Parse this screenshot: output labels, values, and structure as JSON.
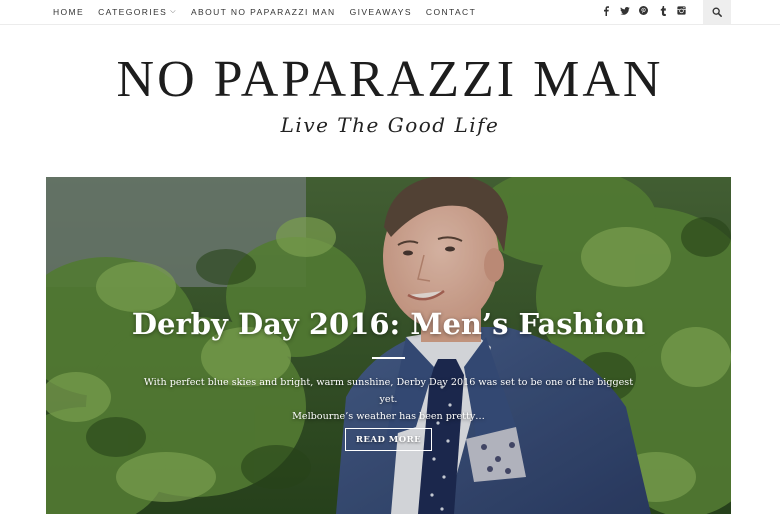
{
  "nav": {
    "items": [
      {
        "label": "HOME"
      },
      {
        "label": "CATEGORIES"
      },
      {
        "label": "ABOUT NO PAPARAZZI MAN"
      },
      {
        "label": "GIVEAWAYS"
      },
      {
        "label": "CONTACT"
      }
    ],
    "social": [
      "facebook-icon",
      "twitter-icon",
      "pinterest-icon",
      "tumblr-icon",
      "instagram-icon"
    ],
    "social_glyphs": [
      "f",
      "🐦",
      "p",
      "t",
      "◙"
    ],
    "search_icon": "search-icon"
  },
  "header": {
    "title": "NO PAPARAZZI MAN",
    "tagline": "Live The Good Life"
  },
  "hero": {
    "title": "Derby Day 2016: Men’s Fashion",
    "excerpt_line1": "With perfect blue skies and bright, warm sunshine, Derby Day 2016 was set to be one of the biggest yet.",
    "excerpt_line2": "Melbourne’s weather has been pretty…",
    "read_more": "READ MORE"
  },
  "colors": {
    "foliage": "#3f6b2a",
    "suit": "#3a4f7a",
    "accent_text": "#ffffff"
  }
}
